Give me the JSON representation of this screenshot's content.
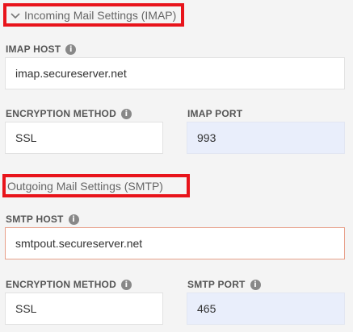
{
  "incoming": {
    "header": "Incoming Mail Settings (IMAP)",
    "host_label": "IMAP HOST",
    "host_value": "imap.secureserver.net",
    "encryption_label": "ENCRYPTION METHOD",
    "encryption_value": "SSL",
    "port_label": "IMAP PORT",
    "port_value": "993"
  },
  "outgoing": {
    "header": "Outgoing Mail Settings (SMTP)",
    "host_label": "SMTP HOST",
    "host_value": "smtpout.secureserver.net",
    "encryption_label": "ENCRYPTION METHOD",
    "encryption_value": "SSL",
    "port_label": "SMTP PORT",
    "port_value": "465"
  },
  "icons": {
    "chevron": "chevron-down-icon",
    "info": "info-icon",
    "info_glyph": "i"
  },
  "colors": {
    "highlight_border": "#e8141b",
    "port_field_bg": "#e9eefb",
    "focused_field_border": "#e8a08a"
  }
}
